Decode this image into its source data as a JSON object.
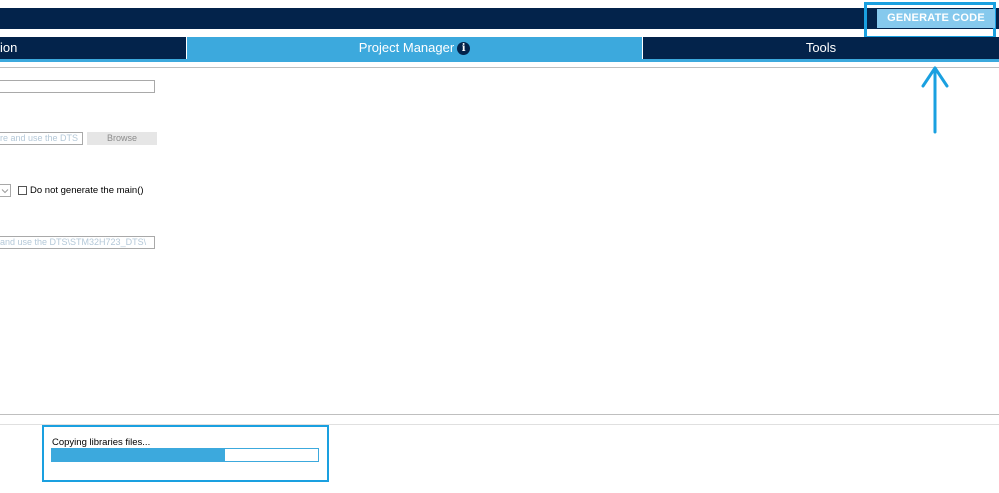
{
  "toolbar": {
    "generate_label": "GENERATE CODE"
  },
  "tabs": [
    {
      "label": "ion"
    },
    {
      "label": "Project Manager"
    },
    {
      "label": "Tools"
    }
  ],
  "icons": {
    "info": "info-icon",
    "dropdown": "chevron-down-icon",
    "arrow": "arrow-up-icon"
  },
  "fields": {
    "project_name": "",
    "location": "re and use the DTS",
    "browse_label": "Browse",
    "do_not_generate_main": "Do not generate the main()",
    "toolchain_folder": "and use the DTS\\STM32H723_DTS\\"
  },
  "progress": {
    "label": "Copying libraries files...",
    "fraction": 0.65
  },
  "colors": {
    "dark_navy": "#03234b",
    "accent_blue": "#3ca9dd",
    "highlight_blue": "#1aa0e0"
  }
}
